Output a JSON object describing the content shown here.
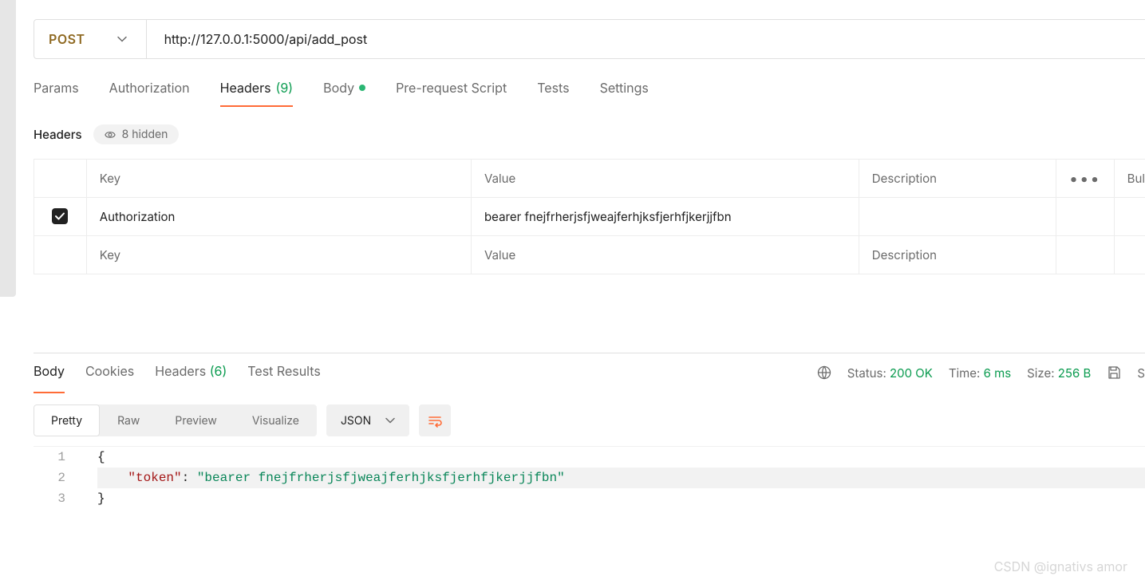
{
  "request": {
    "method": "POST",
    "url": "http://127.0.0.1:5000/api/add_post"
  },
  "tabs": {
    "params": "Params",
    "authorization": "Authorization",
    "headers": "Headers",
    "headers_count": "(9)",
    "body": "Body",
    "prerequest": "Pre-request Script",
    "tests": "Tests",
    "settings": "Settings"
  },
  "headers_section": {
    "title": "Headers",
    "hidden_label": "8 hidden",
    "columns": {
      "key": "Key",
      "value": "Value",
      "description": "Description",
      "bulk": "Bul"
    },
    "rows": [
      {
        "enabled": true,
        "key": "Authorization",
        "value": "bearer fnejfrherjsfjweajferhjksfjerhfjkerjjfbn",
        "description": ""
      }
    ],
    "placeholders": {
      "key": "Key",
      "value": "Value",
      "description": "Description"
    }
  },
  "response": {
    "tabs": {
      "body": "Body",
      "cookies": "Cookies",
      "headers": "Headers",
      "headers_count": "(6)",
      "test_results": "Test Results"
    },
    "meta": {
      "status_label": "Status:",
      "status_value": "200 OK",
      "time_label": "Time:",
      "time_value": "6 ms",
      "size_label": "Size:",
      "size_value": "256 B"
    },
    "view": {
      "pretty": "Pretty",
      "raw": "Raw",
      "preview": "Preview",
      "visualize": "Visualize",
      "format": "JSON"
    },
    "body_json": {
      "lines": [
        "1",
        "2",
        "3"
      ],
      "l1": "{",
      "l2_key": "\"token\"",
      "l2_colon": ": ",
      "l2_val": "\"bearer fnejfrherjsfjweajferhjksfjerhfjkerjjfbn\"",
      "l3": "}"
    }
  },
  "watermark": "CSDN @ignativs  amor"
}
